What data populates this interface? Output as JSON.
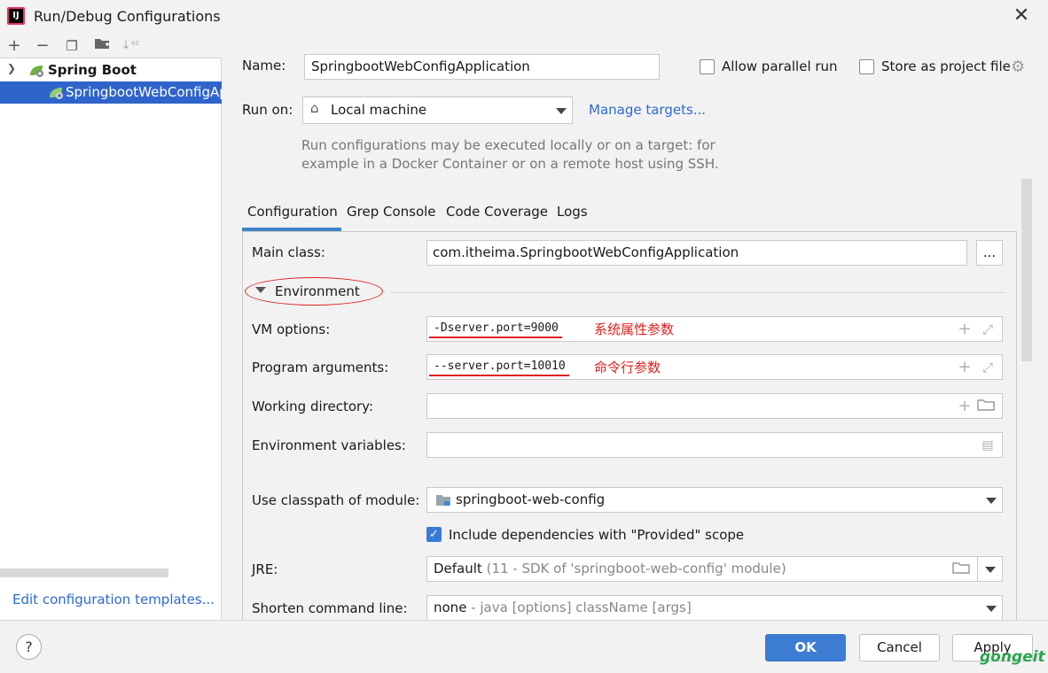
{
  "window": {
    "title": "Run/Debug Configurations",
    "close_icon": "close-icon",
    "app_icon_label": "IJ"
  },
  "left_toolbar": {
    "icons": [
      "plus-icon",
      "minus-icon",
      "copy-icon",
      "folder-add-icon",
      "sort-icon"
    ]
  },
  "tree": {
    "root_label": "Spring Boot",
    "child_label": "SpringbootWebConfigApplication"
  },
  "edit_templates_link": "Edit configuration templates...",
  "form": {
    "name_label": "Name:",
    "name_value": "SpringbootWebConfigApplication",
    "allow_parallel_label": "Allow parallel run",
    "allow_parallel_checked": false,
    "store_project_label": "Store as project file",
    "store_project_checked": false,
    "run_on_label": "Run on:",
    "run_on_value": "Local machine",
    "manage_targets_link": "Manage targets...",
    "hint_line1": "Run configurations may be executed locally or on a target: for",
    "hint_line2": "example in a Docker Container or on a remote host using SSH."
  },
  "tabs": [
    {
      "label": "Configuration",
      "selected": true
    },
    {
      "label": "Grep Console",
      "selected": false
    },
    {
      "label": "Code Coverage",
      "selected": false
    },
    {
      "label": "Logs",
      "selected": false
    }
  ],
  "config": {
    "main_class_label": "Main class:",
    "main_class_value": "com.itheima.SpringbootWebConfigApplication",
    "browse_button": "...",
    "environment_label": "Environment",
    "vm_options_label": "VM options:",
    "vm_options_value": "-Dserver.port=9000",
    "vm_options_annotation": "系统属性参数",
    "program_args_label": "Program arguments:",
    "program_args_value": "--server.port=10010",
    "program_args_annotation": "命令行参数",
    "working_dir_label": "Working directory:",
    "working_dir_value": "",
    "env_vars_label": "Environment variables:",
    "env_vars_value": "",
    "classpath_label": "Use classpath of module:",
    "classpath_value": "springboot-web-config",
    "include_deps_label": "Include dependencies with \"Provided\" scope",
    "include_deps_checked": true,
    "jre_label": "JRE:",
    "jre_value": "Default",
    "jre_detail": "(11 - SDK of 'springboot-web-config' module)",
    "shorten_label": "Shorten command line:",
    "shorten_value": "none",
    "shorten_detail": "- java [options] className [args]"
  },
  "buttons": {
    "help": "?",
    "ok": "OK",
    "cancel": "Cancel",
    "apply": "Apply"
  },
  "watermark": "gongeit",
  "colors": {
    "accent": "#3c7dd1",
    "selection": "#2f65ca",
    "annotation_red": "#e02020",
    "link": "#2e6ad0"
  }
}
